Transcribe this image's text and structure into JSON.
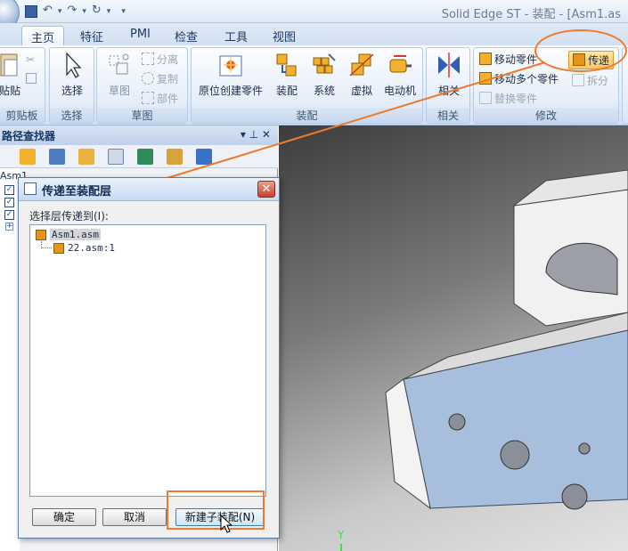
{
  "window": {
    "title": "Solid Edge ST - 装配 - [Asm1.as",
    "qat_customize": "▾"
  },
  "tabs": [
    {
      "label": "主页",
      "active": true
    },
    {
      "label": "特征"
    },
    {
      "label": "PMI"
    },
    {
      "label": "检查"
    },
    {
      "label": "工具"
    },
    {
      "label": "视图"
    }
  ],
  "ribbon": {
    "clipboard": {
      "label": "剪贴板",
      "paste": "贴贴"
    },
    "select": {
      "label": "选择",
      "select_btn": "选择"
    },
    "sketch": {
      "label": "草图",
      "sketch_btn": "草图",
      "separate": "分离",
      "copy": "复制",
      "part": "部件"
    },
    "assembly": {
      "label": "装配",
      "place_in_position": "原位创建零件",
      "assemble": "装配",
      "system": "系统",
      "virtual": "虚拟",
      "motor": "电动机"
    },
    "relate": {
      "label": "相关",
      "relate_btn": "相关"
    },
    "modify": {
      "label": "修改",
      "move_part": "移动零件",
      "move_multiple": "移动多个零件",
      "replace_part": "替换零件",
      "transfer": "传递",
      "disperse": "拆分"
    }
  },
  "pathfinder": {
    "title": "路径查找器",
    "controls": "▾ ⊥ ✕",
    "root_item": "Asm1",
    "checkbox_mark": "✓",
    "expand_mark": "+"
  },
  "dialog": {
    "title": "传递至装配层",
    "close": "✕",
    "prompt": "选择层传递到(I):",
    "tree": [
      {
        "label": "Asm1.asm",
        "selected": true
      },
      {
        "label": "22.asm:1"
      }
    ],
    "ok": "确定",
    "cancel": "取消",
    "new_subassembly": "新建子装配(N)"
  },
  "viewport": {
    "axis_label": "Y"
  },
  "colors": {
    "highlight": "#ef7a2e",
    "ribbon_bg": "#dfe9f6",
    "part_face": "#a8bedd"
  }
}
